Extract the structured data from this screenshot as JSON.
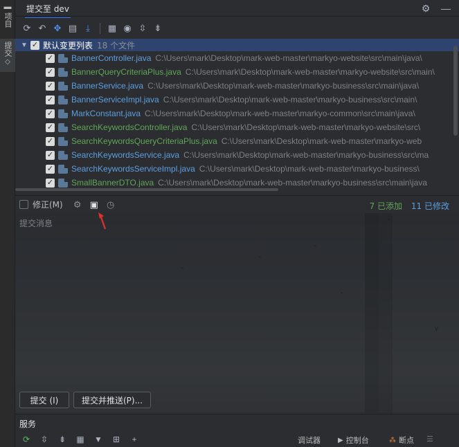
{
  "left_strip": {
    "tab_project": "项目",
    "tab_commit": "提交"
  },
  "header": {
    "title": "提交至 dev"
  },
  "changes": {
    "root_label": "默认变更列表",
    "root_count": "18 个文件",
    "files": [
      {
        "name": "BannerController.java",
        "path": "C:\\Users\\mark\\Desktop\\mark-web-master\\markyo-website\\src\\main\\java\\",
        "status": "mod"
      },
      {
        "name": "BannerQueryCriteriaPlus.java",
        "path": "C:\\Users\\mark\\Desktop\\mark-web-master\\markyo-website\\src\\main\\",
        "status": "add"
      },
      {
        "name": "BannerService.java",
        "path": "C:\\Users\\mark\\Desktop\\mark-web-master\\markyo-business\\src\\main\\java\\",
        "status": "mod"
      },
      {
        "name": "BannerServiceImpl.java",
        "path": "C:\\Users\\mark\\Desktop\\mark-web-master\\markyo-business\\src\\main\\",
        "status": "mod"
      },
      {
        "name": "MarkConstant.java",
        "path": "C:\\Users\\mark\\Desktop\\mark-web-master\\markyo-common\\src\\main\\java\\",
        "status": "mod"
      },
      {
        "name": "SearchKeywordsController.java",
        "path": "C:\\Users\\mark\\Desktop\\mark-web-master\\markyo-website\\src\\",
        "status": "add"
      },
      {
        "name": "SearchKeywordsQueryCriteriaPlus.java",
        "path": "C:\\Users\\mark\\Desktop\\mark-web-master\\markyo-web",
        "status": "add"
      },
      {
        "name": "SearchKeywordsService.java",
        "path": "C:\\Users\\mark\\Desktop\\mark-web-master\\markyo-business\\src\\ma",
        "status": "mod"
      },
      {
        "name": "SearchKeywordsServiceImpl.java",
        "path": "C:\\Users\\mark\\Desktop\\mark-web-master\\markyo-business\\",
        "status": "mod"
      },
      {
        "name": "SmallBannerDTO.java",
        "path": "C:\\Users\\mark\\Desktop\\mark-web-master\\markyo-business\\src\\main\\java",
        "status": "add"
      }
    ]
  },
  "amend": {
    "label": "修正(M)",
    "added": "7 已添加",
    "modified": "11 已修改"
  },
  "message": {
    "placeholder": "提交消息"
  },
  "buttons": {
    "commit": "提交 (I)",
    "commit_push": "提交并推送(P)..."
  },
  "services": {
    "title": "服务",
    "debugger": "调试器",
    "console": "控制台",
    "breakpoints": "断点"
  },
  "colors": {
    "accent": "#3574f0",
    "added": "#62a55a",
    "modified": "#5e9fe0",
    "selected_row": "#2e436e"
  }
}
